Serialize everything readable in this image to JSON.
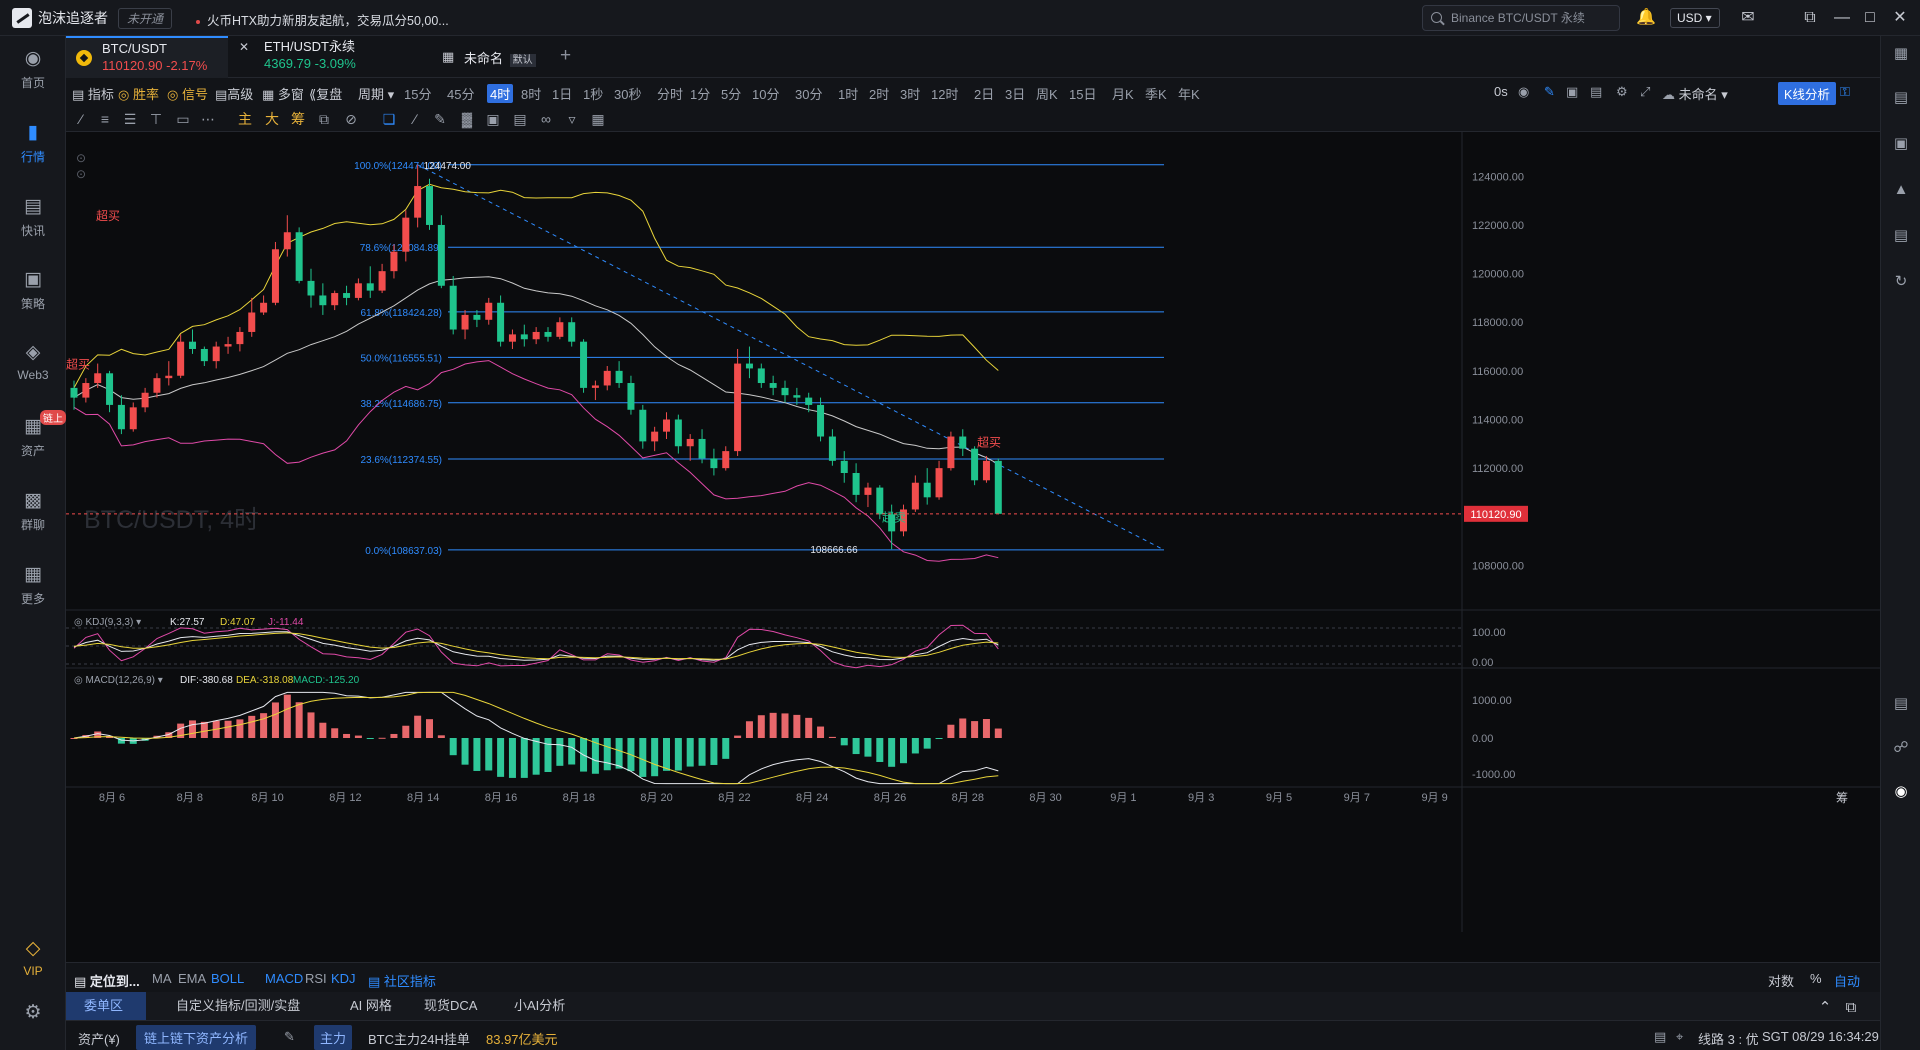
{
  "titlebar": {
    "app_name": "泡沫追逐者",
    "status_badge": "未开通",
    "news": "火币HTX助力新朋友起航，交易瓜分50,00...",
    "search_placeholder": "Binance BTC/USDT 永续",
    "currency": "USD"
  },
  "nav": [
    {
      "label": "首页",
      "icon": "home-icon"
    },
    {
      "label": "行情",
      "icon": "market-chart-icon",
      "active": true
    },
    {
      "label": "快讯",
      "icon": "news-icon"
    },
    {
      "label": "策略",
      "icon": "strategy-robot-icon"
    },
    {
      "label": "Web3",
      "icon": "web3-icon"
    },
    {
      "label": "资产",
      "icon": "wallet-icon",
      "tag": "链上"
    },
    {
      "label": "群聊",
      "icon": "chat-icon"
    },
    {
      "label": "更多",
      "icon": "more-grid-icon"
    },
    {
      "label": "VIP",
      "icon": "vip-diamond-icon"
    }
  ],
  "tabs": [
    {
      "name": "BTC/USDT",
      "price": "110120.90",
      "change": "-2.17%"
    },
    {
      "name": "ETH/USDT永续",
      "price": "4369.79",
      "change": "-3.09%"
    },
    {
      "name": "未命名",
      "badge": "默认"
    }
  ],
  "toolbar": {
    "indicator": "指标",
    "win_rate": "胜率",
    "signal": "信号",
    "advanced": "高级",
    "multi_window": "多窗",
    "replay": "复盘",
    "period": "周期",
    "periods": [
      "15分",
      "45分",
      "4时",
      "8时",
      "1日",
      "1秒",
      "30秒",
      "分时",
      "1分",
      "5分",
      "10分",
      "30分",
      "1时",
      "2时",
      "3时",
      "12时",
      "2日",
      "3日",
      "周K",
      "15日",
      "月K",
      "季K",
      "年K"
    ],
    "active_period": "4时",
    "countdown": "0s",
    "layout_name": "未命名",
    "k_analysis": "K线分析"
  },
  "draw_tools": {
    "main": "主",
    "large": "大",
    "chip": "筹"
  },
  "chart_data": {
    "type": "candlestick",
    "symbol_watermark": "BTC/USDT, 4时",
    "x_ticks": [
      "8月 6",
      "8月 8",
      "8月 10",
      "8月 12",
      "8月 14",
      "8月 16",
      "8月 18",
      "8月 20",
      "8月 22",
      "8月 24",
      "8月 26",
      "8月 28",
      "8月 30",
      "9月 1",
      "9月 3",
      "9月 5",
      "9月 7",
      "9月 9"
    ],
    "y_ticks": [
      "124000.00",
      "122000.00",
      "120000.00",
      "118000.00",
      "116000.00",
      "114000.00",
      "112000.00",
      "110000.00",
      "108000.00"
    ],
    "ylim": [
      107400,
      125000
    ],
    "last_price": "110120.90",
    "high_label": "124474.00",
    "low_label": "108666.66",
    "signal_labels": [
      "超买",
      "超买",
      "超买",
      "超卖"
    ],
    "fib_levels": [
      {
        "label": "100.0%(124474.00)",
        "price": 124474
      },
      {
        "label": "78.6%(121084.89)",
        "price": 121084.89
      },
      {
        "label": "61.8%(118424.28)",
        "price": 118424.28
      },
      {
        "label": "50.0%(116555.51)",
        "price": 116555.51
      },
      {
        "label": "38.2%(114686.75)",
        "price": 114686.75
      },
      {
        "label": "23.6%(112374.55)",
        "price": 112374.55
      },
      {
        "label": "0.0%(108637.03)",
        "price": 108637.03
      }
    ],
    "candles": [
      [
        115300,
        115600,
        114400,
        114900
      ],
      [
        114900,
        115700,
        114700,
        115500
      ],
      [
        115500,
        116300,
        115300,
        115900
      ],
      [
        115900,
        116000,
        114300,
        114600
      ],
      [
        114600,
        115000,
        113400,
        113600
      ],
      [
        113600,
        114700,
        113500,
        114500
      ],
      [
        114500,
        115300,
        114300,
        115100
      ],
      [
        115100,
        115900,
        114900,
        115700
      ],
      [
        115700,
        116400,
        115400,
        115800
      ],
      [
        115800,
        117500,
        115700,
        117200
      ],
      [
        117200,
        117700,
        116700,
        116900
      ],
      [
        116900,
        117000,
        116200,
        116400
      ],
      [
        116400,
        117200,
        116100,
        117000
      ],
      [
        117000,
        117400,
        116700,
        117100
      ],
      [
        117100,
        117800,
        116800,
        117600
      ],
      [
        117600,
        119000,
        117400,
        118400
      ],
      [
        118400,
        119100,
        118300,
        118800
      ],
      [
        118800,
        121300,
        118700,
        121000
      ],
      [
        121000,
        122400,
        120700,
        121700
      ],
      [
        121700,
        121900,
        119600,
        119700
      ],
      [
        119700,
        120200,
        118600,
        119100
      ],
      [
        119100,
        119600,
        118300,
        118700
      ],
      [
        118700,
        119300,
        118500,
        119200
      ],
      [
        119200,
        119500,
        118700,
        119000
      ],
      [
        119000,
        119800,
        118900,
        119600
      ],
      [
        119600,
        120300,
        119000,
        119300
      ],
      [
        119300,
        120400,
        119200,
        120100
      ],
      [
        120100,
        121200,
        119800,
        120900
      ],
      [
        120900,
        122600,
        120500,
        122300
      ],
      [
        122300,
        124474,
        121900,
        123600
      ],
      [
        123600,
        123900,
        121800,
        122000
      ],
      [
        122000,
        122400,
        119400,
        119500
      ],
      [
        119500,
        119900,
        117500,
        117700
      ],
      [
        117700,
        118500,
        117300,
        118300
      ],
      [
        118300,
        118500,
        117800,
        118100
      ],
      [
        118100,
        119000,
        117900,
        118800
      ],
      [
        118800,
        119100,
        117000,
        117200
      ],
      [
        117200,
        117700,
        116900,
        117500
      ],
      [
        117500,
        117900,
        117000,
        117300
      ],
      [
        117300,
        117800,
        117100,
        117600
      ],
      [
        117600,
        117800,
        117200,
        117400
      ],
      [
        117400,
        118200,
        117300,
        118000
      ],
      [
        118000,
        118200,
        117000,
        117200
      ],
      [
        117200,
        117300,
        115100,
        115300
      ],
      [
        115300,
        115600,
        114800,
        115400
      ],
      [
        115400,
        116200,
        115200,
        116000
      ],
      [
        116000,
        116400,
        115300,
        115500
      ],
      [
        115500,
        115800,
        114200,
        114400
      ],
      [
        114400,
        114600,
        112800,
        113100
      ],
      [
        113100,
        113700,
        112700,
        113500
      ],
      [
        113500,
        114300,
        113200,
        114000
      ],
      [
        114000,
        114200,
        112600,
        112900
      ],
      [
        112900,
        113400,
        112300,
        113200
      ],
      [
        113200,
        113600,
        112200,
        112400
      ],
      [
        112400,
        112800,
        111700,
        112000
      ],
      [
        112000,
        112900,
        111900,
        112700
      ],
      [
        112700,
        116900,
        112500,
        116300
      ],
      [
        116300,
        117000,
        115700,
        116100
      ],
      [
        116100,
        116300,
        115300,
        115500
      ],
      [
        115500,
        115800,
        115000,
        115300
      ],
      [
        115300,
        115600,
        114700,
        115000
      ],
      [
        115000,
        115300,
        114600,
        114900
      ],
      [
        114900,
        115100,
        114300,
        114600
      ],
      [
        114600,
        114900,
        113100,
        113300
      ],
      [
        113300,
        113600,
        112100,
        112300
      ],
      [
        112300,
        112700,
        111400,
        111800
      ],
      [
        111800,
        112200,
        110600,
        110900
      ],
      [
        110900,
        111400,
        110400,
        111200
      ],
      [
        111200,
        111300,
        109900,
        110100
      ],
      [
        110100,
        110500,
        108666.66,
        109400
      ],
      [
        109400,
        110500,
        109200,
        110300
      ],
      [
        110300,
        111700,
        110200,
        111400
      ],
      [
        111400,
        112000,
        110500,
        110800
      ],
      [
        110800,
        112300,
        110700,
        112000
      ],
      [
        112000,
        113500,
        111900,
        113300
      ],
      [
        113300,
        113600,
        112500,
        112800
      ],
      [
        112800,
        112900,
        111300,
        111500
      ],
      [
        111500,
        112500,
        111400,
        112300
      ],
      [
        112300,
        112400,
        110100,
        110120.9
      ]
    ],
    "kdj": {
      "label": "KDJ(9,3,3)",
      "k": "27.57",
      "d": "47.07",
      "j": "-11.44",
      "y_ticks": [
        "100.00",
        "0.00"
      ]
    },
    "macd": {
      "label": "MACD(12,26,9)",
      "dif": "-380.68",
      "dea": "-318.08",
      "macd": "-125.20",
      "y_ticks": [
        "1000.00",
        "0.00",
        "-1000.00"
      ]
    }
  },
  "indicators": {
    "locate": "定位到...",
    "main": [
      "MA",
      "EMA",
      "BOLL"
    ],
    "sub": [
      "MACD",
      "RSI",
      "KDJ"
    ],
    "community": "社区指标",
    "scale_log": "对数",
    "scale_pct": "%",
    "scale_auto": "自动"
  },
  "bottom_tabs": [
    "委单区",
    "自定义指标/回测/实盘",
    "AI 网格",
    "现货DCA",
    "小AI分析"
  ],
  "status": {
    "assets": "资产(¥)",
    "onchain": "链上链下资产分析",
    "main_force": "主力",
    "btc_label": "BTC主力24H挂单",
    "btc_amount": "83.97亿美元",
    "line": "线路 3 : 优",
    "clock": "SGT  08/29 16:34:29"
  },
  "colors": {
    "up": "#f24d4d",
    "down": "#1fc48d",
    "accent": "#2f8cff",
    "boll_upper": "#e8d43a",
    "boll_mid": "#c9c9c9",
    "boll_lower": "#e04aa8",
    "fib": "#2f8cff"
  }
}
